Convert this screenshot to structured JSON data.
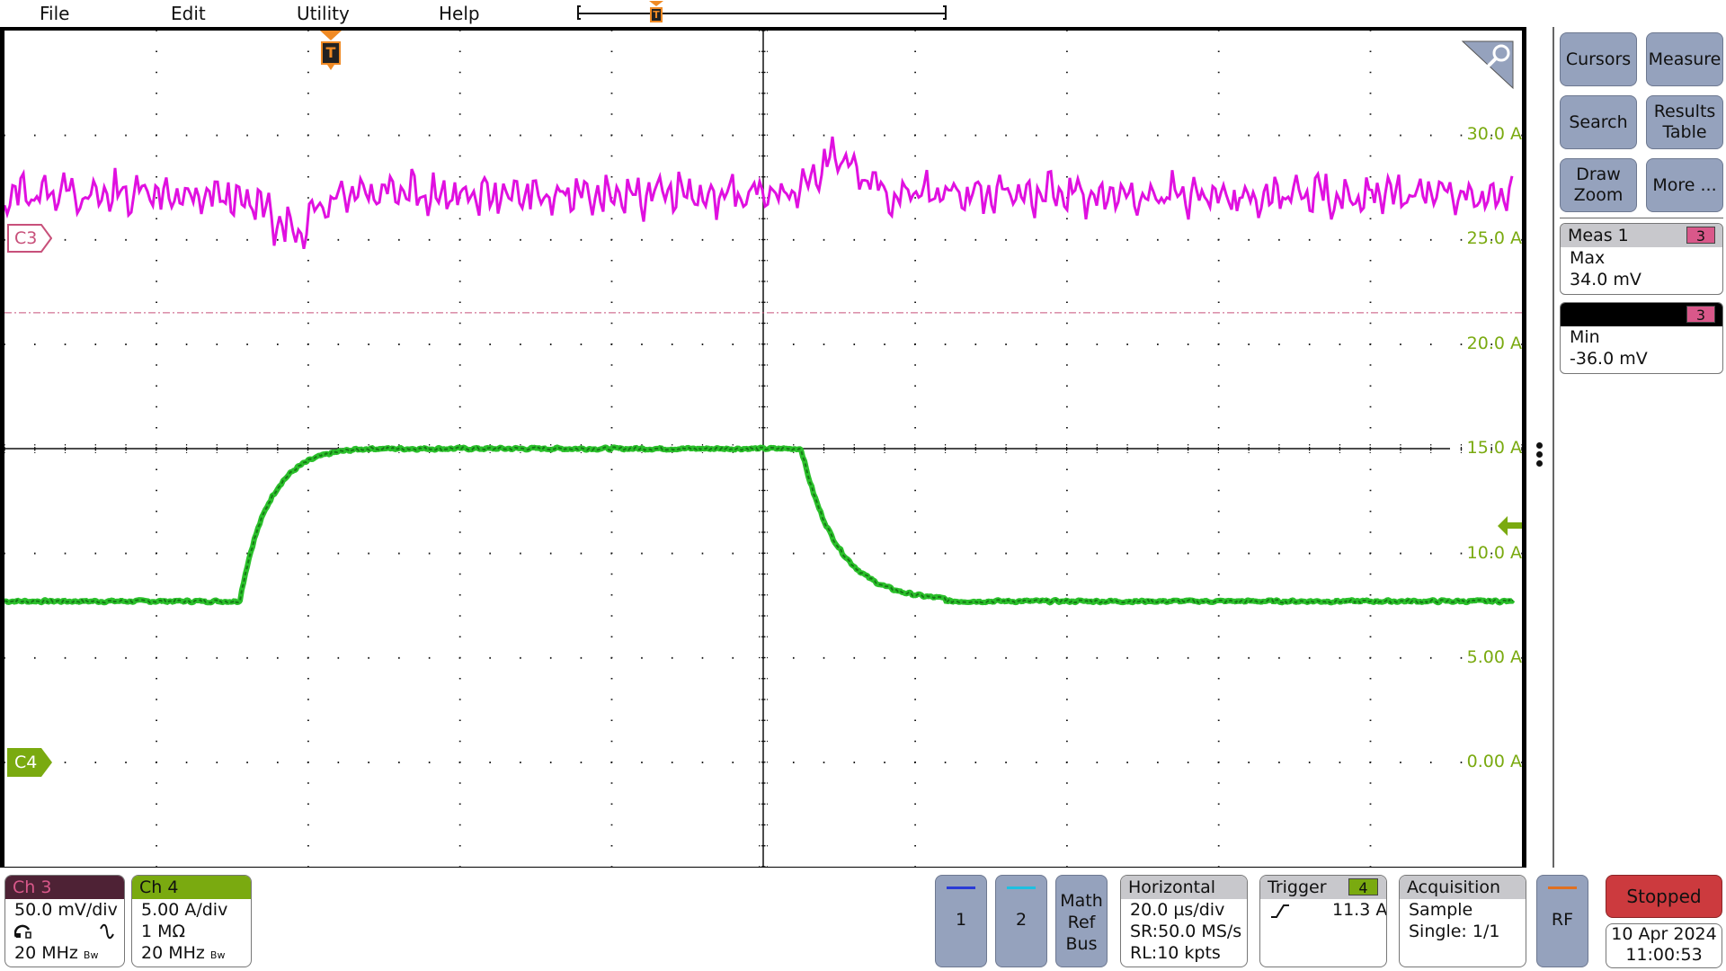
{
  "menu": {
    "items": [
      "File",
      "Edit",
      "Utility",
      "Help"
    ]
  },
  "timeline": {
    "trigger_marker_label": "T"
  },
  "graticule": {
    "h_divisions": 10,
    "v_divisions": 8,
    "trigger_marker_label": "T",
    "scale_labels": [
      "30.0 A",
      "25.0 A",
      "20.0 A",
      "15.0 A",
      "10.0 A",
      "5.00 A",
      "0.00 A"
    ],
    "zoom_icon": "magnifier-icon",
    "trigger_level_icon": "arrow-left-icon"
  },
  "channels": {
    "ch3": {
      "marker": "C3",
      "color": "#e010e0",
      "marker_color": "#c8507a"
    },
    "ch4": {
      "marker": "C4",
      "color": "#2bc02b",
      "marker_color": "#7aaa10"
    }
  },
  "waveforms": {
    "ch4_current_A": {
      "low_level": 7.7,
      "high_level": 15.0,
      "rise_start_div": 1.55,
      "rise_end_div": 2.4,
      "fall_start_div": 5.25,
      "fall_end_div": 5.9,
      "trigger_level": 11.3
    },
    "ch3_voltage": {
      "center_div_from_top": 2.0,
      "dip_div": 1.9,
      "bump_div": 5.5,
      "reference_line_div_from_top": 2.7
    }
  },
  "right_panel": {
    "buttons": [
      {
        "label": "Cursors"
      },
      {
        "label": "Measure"
      },
      {
        "label": "Search"
      },
      {
        "label": "Results Table"
      },
      {
        "label": "Draw Zoom"
      },
      {
        "label": "More ..."
      }
    ],
    "meas1": {
      "title": "Meas 1",
      "source": "3",
      "type": "Max",
      "value": "34.0 mV"
    },
    "meas2": {
      "title": "",
      "source": "3",
      "type": "Min",
      "value": "-36.0 mV"
    }
  },
  "bottom": {
    "ch3": {
      "title": "Ch 3",
      "scale": "50.0 mV/div",
      "bw": "20 MHz",
      "bw_icon": "Bw",
      "probe_icon": "probe-icon",
      "coupling_icon": "ac-coupling-icon"
    },
    "ch4": {
      "title": "Ch 4",
      "scale": "5.00 A/div",
      "impedance": "1 MΩ",
      "bw": "20 MHz",
      "bw_icon": "Bw"
    },
    "btn1": {
      "label": "1",
      "color": "#2a3bd6"
    },
    "btn2": {
      "label": "2",
      "color": "#1ec0e0"
    },
    "math": {
      "label1": "Math",
      "label2": "Ref",
      "label3": "Bus"
    },
    "horizontal": {
      "title": "Horizontal",
      "scale": "20.0 µs/div",
      "sr": "SR:50.0 MS/s",
      "rl": "RL:10 kpts"
    },
    "trigger": {
      "title": "Trigger",
      "source": "4",
      "slope_icon": "rising-edge-icon",
      "level": "11.3 A"
    },
    "acquisition": {
      "title": "Acquisition",
      "mode": "Sample",
      "count": "Single: 1/1"
    },
    "rf": {
      "label": "RF",
      "color": "#e07020"
    },
    "status": {
      "label": "Stopped"
    },
    "date": "10 Apr 2024",
    "time": "11:00:53"
  }
}
